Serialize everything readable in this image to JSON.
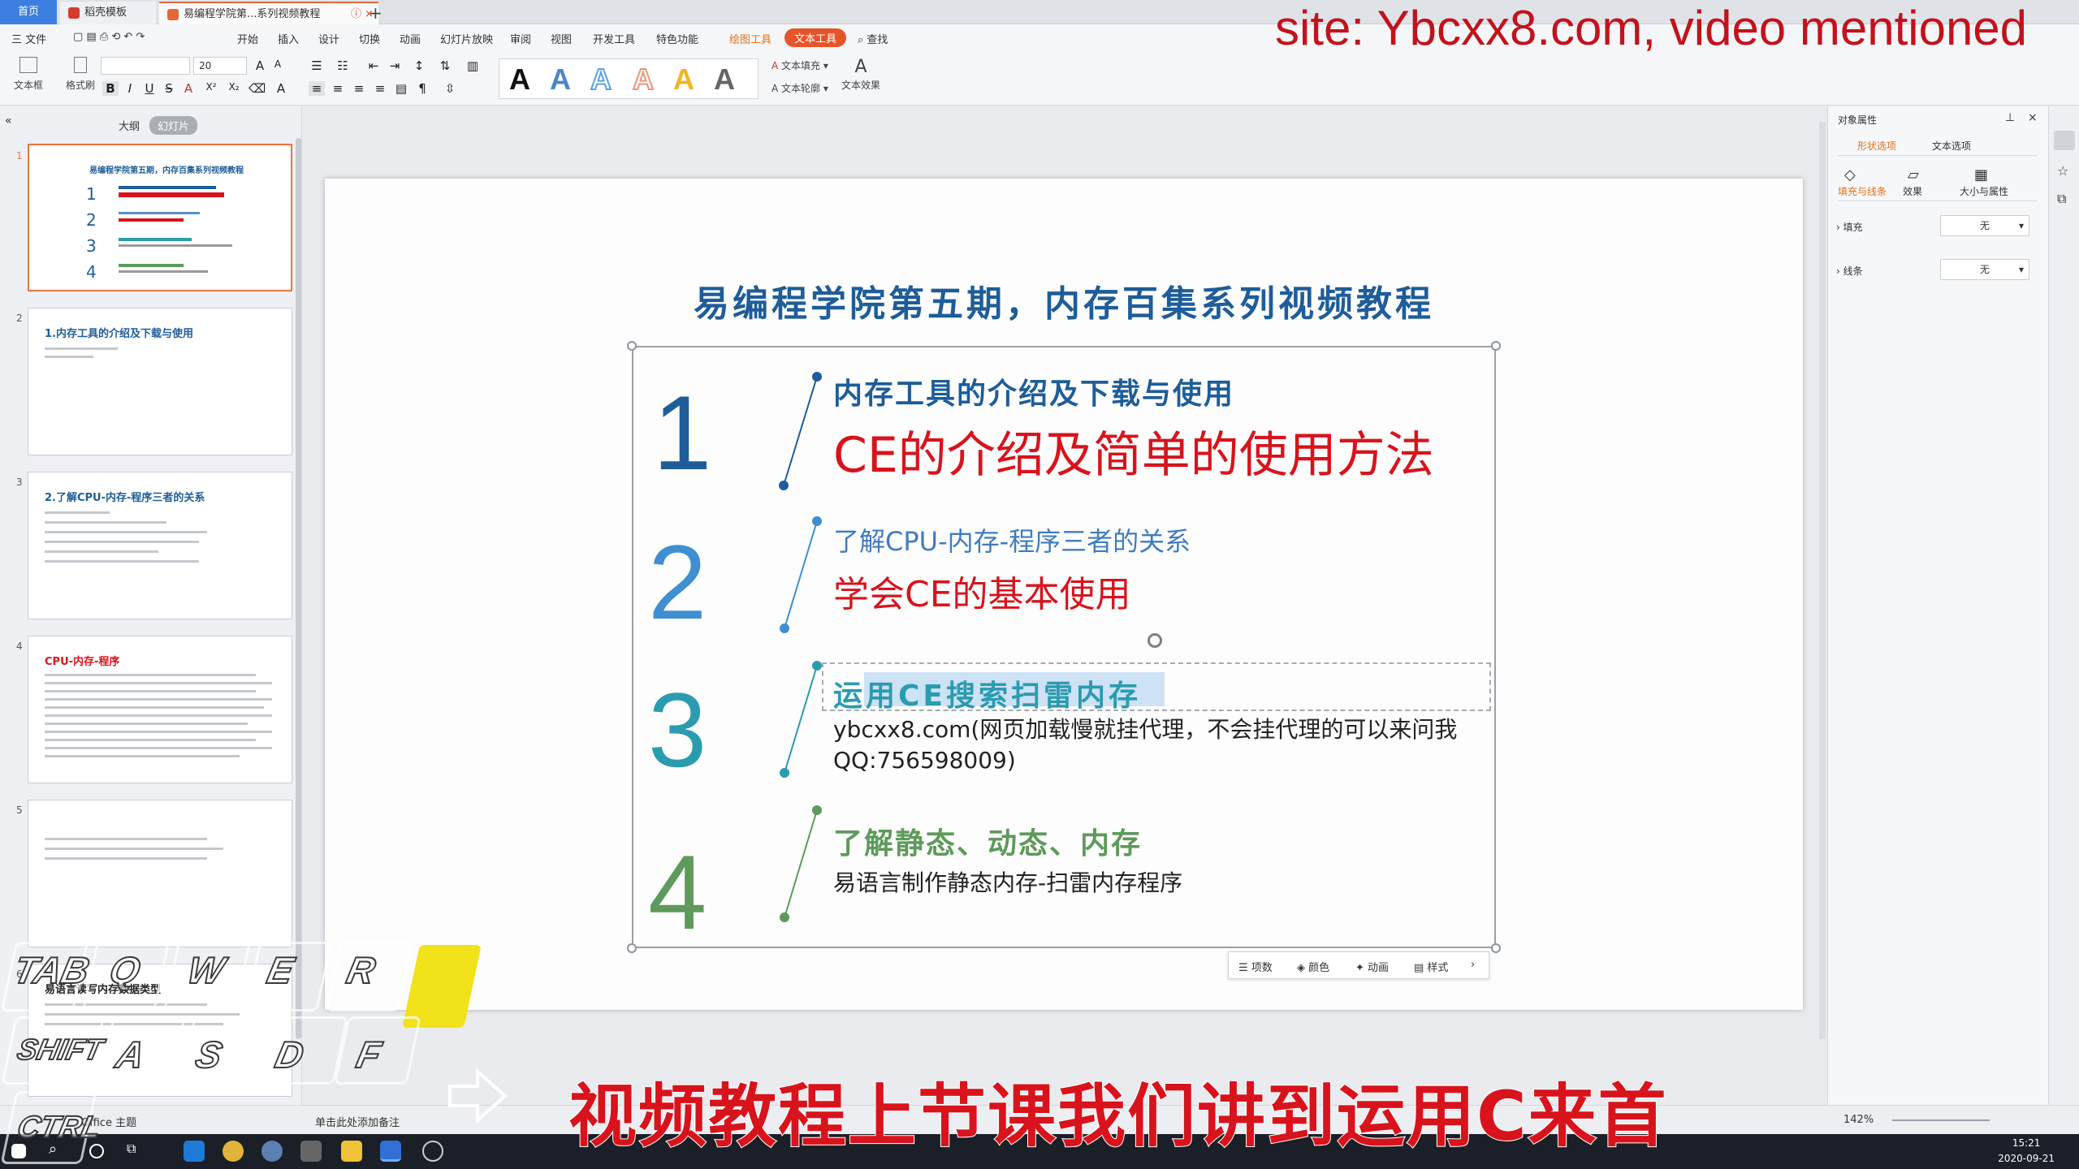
{
  "tabs": {
    "home": "首页",
    "templates": "稻壳模板",
    "document": "易编程学院第...系列视频教程"
  },
  "menu": [
    "三 文件",
    "开始",
    "插入",
    "设计",
    "切换",
    "动画",
    "幻灯片放映",
    "审阅",
    "视图",
    "开发工具",
    "特色功能",
    "绘图工具",
    "文本工具",
    "查找"
  ],
  "toolbar": {
    "textbox": "文本框",
    "format_painter": "格式刷",
    "font_size": "20",
    "text_fill": "文本填充",
    "text_outline": "文本轮廓",
    "text_effect": "文本效果"
  },
  "left_panel": {
    "outline_tab": "大纲",
    "slides_tab": "幻灯片",
    "thumbnails": [
      {
        "num": "1",
        "title": "易编程学院第五期，内存百集系列视频教程"
      },
      {
        "num": "2",
        "title": "1.内存工具的介绍及下载与使用"
      },
      {
        "num": "3",
        "title": "2.了解CPU-内存-程序三者的关系"
      },
      {
        "num": "4",
        "title": "CPU-内存-程序"
      },
      {
        "num": "5",
        "title": ""
      },
      {
        "num": "6",
        "title": "易语言读写内存数据类型"
      }
    ]
  },
  "slide": {
    "title": "易编程学院第五期，内存百集系列视频教程",
    "items": [
      {
        "num": "1",
        "heading": "内存工具的介绍及下载与使用",
        "sub": "CE的介绍及简单的使用方法"
      },
      {
        "num": "2",
        "heading": "了解CPU-内存-程序三者的关系",
        "sub": "学会CE的基本使用"
      },
      {
        "num": "3",
        "heading": "运用CE搜索扫雷内存",
        "sub": "ybcxx8.com(网页加载慢就挂代理，不会挂代理的可以来问我QQ:756598009)"
      },
      {
        "num": "4",
        "heading": "了解静态、动态、内存",
        "sub": "易语言制作静态内存-扫雷内存程序"
      }
    ]
  },
  "float_toolbar": [
    "项数",
    "颜色",
    "动画",
    "样式"
  ],
  "right_panel": {
    "title": "对象属性",
    "tab_shape": "形状选项",
    "tab_text": "文本选项",
    "sub_fill_line": "填充与线条",
    "sub_effect": "效果",
    "sub_size": "大小与属性",
    "fill_label": "填充",
    "fill_value": "无",
    "line_label": "线条",
    "line_value": "无"
  },
  "statusbar": {
    "notes_placeholder": "单击此处添加备注",
    "theme": "Office 主题",
    "zoom": "142%"
  },
  "taskbar": {
    "time": "15:21",
    "date": "2020-09-21"
  },
  "overlay": {
    "watermark": "site: Ybcxx8.com, video mentioned",
    "subtitle": "视频教程上节课我们讲到运用C来首"
  },
  "keys": {
    "tab": "TAB",
    "q": "Q",
    "w": "W",
    "e": "E",
    "r": "R",
    "shift": "SHIFT",
    "a": "A",
    "s": "S",
    "d": "D",
    "f": "F",
    "ctrl": "CTRL"
  },
  "colors": {
    "accent_blue": "#1e5d99",
    "accent_red": "#d8131c",
    "teal": "#2b9bb0",
    "green": "#5e9a5b",
    "wps_orange": "#e8542a"
  }
}
